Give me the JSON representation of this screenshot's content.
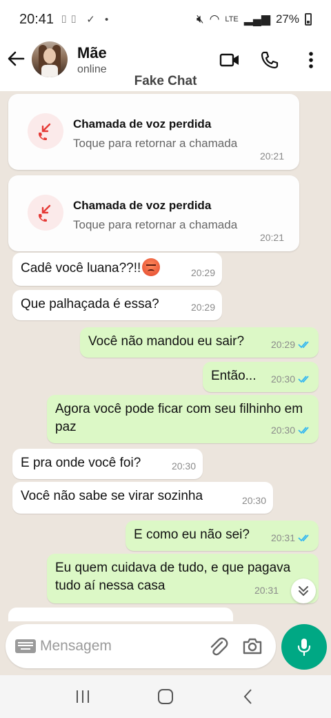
{
  "status_bar": {
    "time": "20:41",
    "battery": "27%",
    "network": "LTE"
  },
  "header": {
    "contact_name": "Mãe",
    "contact_status": "online",
    "watermark": "Fake Chat"
  },
  "messages": [
    {
      "type": "call",
      "title": "Chamada de voz perdida",
      "subtitle": "Toque para retornar a chamada",
      "time": "20:21"
    },
    {
      "type": "call",
      "title": "Chamada de voz perdida",
      "subtitle": "Toque para retornar a chamada",
      "time": "20:21"
    },
    {
      "type": "in",
      "text": "Cadê você luana??!!",
      "time": "20:29",
      "emoji": "angry-face"
    },
    {
      "type": "in",
      "text": "Que palhaçada é essa?",
      "time": "20:29"
    },
    {
      "type": "out",
      "text": "Você não mandou eu sair?",
      "time": "20:29"
    },
    {
      "type": "out",
      "text": "Então...",
      "time": "20:30"
    },
    {
      "type": "out",
      "text": "Agora você pode ficar com seu filhinho em paz",
      "time": "20:30"
    },
    {
      "type": "in",
      "text": "E pra onde você foi?",
      "time": "20:30"
    },
    {
      "type": "in",
      "text": "Você não sabe se virar sozinha",
      "time": "20:30"
    },
    {
      "type": "out",
      "text": "E como eu não sei?",
      "time": "20:31"
    },
    {
      "type": "out",
      "text": "Eu quem cuidava de tudo, e que pagava tudo aí nessa casa",
      "time": "20:31"
    }
  ],
  "input": {
    "placeholder": "Mensagem"
  },
  "colors": {
    "incoming_bubble": "#ffffff",
    "outgoing_bubble": "#dcf8c6",
    "chat_background": "#ece5dd",
    "accent": "#00a884",
    "read_ticks": "#34b7f1",
    "missed_call": "#e53935"
  },
  "icons": [
    "back-arrow-icon",
    "video-call-icon",
    "voice-call-icon",
    "more-options-icon",
    "missed-call-icon",
    "read-receipt-icon",
    "keyboard-icon",
    "attach-icon",
    "camera-icon",
    "mic-icon",
    "scroll-down-icon",
    "recent-apps-icon",
    "home-icon",
    "back-nav-icon"
  ]
}
